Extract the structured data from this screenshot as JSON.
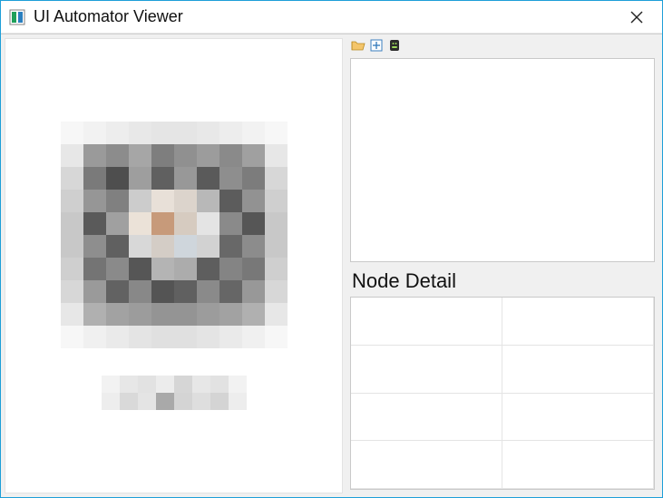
{
  "window": {
    "title": "UI Automator Viewer"
  },
  "rightPanel": {
    "nodeDetailLabel": "Node Detail"
  },
  "icons": {
    "open": "open-folder-icon",
    "screenshot": "screenshot-icon",
    "device": "device-icon",
    "close": "close-icon",
    "app": "app-icon"
  },
  "pixelArt": {
    "rows": [
      [
        "#f7f7f7",
        "#f2f2f2",
        "#ededed",
        "#e8e8e8",
        "#e5e5e5",
        "#e5e5e5",
        "#e8e8e8",
        "#ededed",
        "#f2f2f2",
        "#f7f7f7"
      ],
      [
        "#e7e7e7",
        "#9a9a9a",
        "#8c8c8c",
        "#a6a6a6",
        "#7e7e7e",
        "#909090",
        "#9c9c9c",
        "#8a8a8a",
        "#a0a0a0",
        "#e7e7e7"
      ],
      [
        "#d7d7d7",
        "#7a7a7a",
        "#4e4e4e",
        "#9e9e9e",
        "#606060",
        "#989898",
        "#5a5a5a",
        "#8e8e8e",
        "#7c7c7c",
        "#d7d7d7"
      ],
      [
        "#cfcfcf",
        "#969696",
        "#808080",
        "#cccccc",
        "#e8e0d8",
        "#dcd4cc",
        "#b8b8b8",
        "#5c5c5c",
        "#929292",
        "#cfcfcf"
      ],
      [
        "#c8c8c8",
        "#5a5a5a",
        "#a0a0a0",
        "#ebe2d8",
        "#c79a7a",
        "#d6cbc0",
        "#e4e4e4",
        "#8a8a8a",
        "#565656",
        "#c8c8c8"
      ],
      [
        "#c8c8c8",
        "#8e8e8e",
        "#606060",
        "#d8d8d8",
        "#d4cdc6",
        "#cfd6dc",
        "#d2d2d2",
        "#686868",
        "#8c8c8c",
        "#c8c8c8"
      ],
      [
        "#cfcfcf",
        "#747474",
        "#8a8a8a",
        "#565656",
        "#b4b4b4",
        "#acacac",
        "#5e5e5e",
        "#848484",
        "#787878",
        "#cfcfcf"
      ],
      [
        "#d7d7d7",
        "#9a9a9a",
        "#626262",
        "#888888",
        "#545454",
        "#606060",
        "#8a8a8a",
        "#666666",
        "#989898",
        "#d7d7d7"
      ],
      [
        "#e7e7e7",
        "#b0b0b0",
        "#a2a2a2",
        "#9c9c9c",
        "#949494",
        "#949494",
        "#9c9c9c",
        "#a2a2a2",
        "#b0b0b0",
        "#e7e7e7"
      ],
      [
        "#f7f7f7",
        "#f0f0f0",
        "#eaeaea",
        "#e4e4e4",
        "#e0e0e0",
        "#e0e0e0",
        "#e4e4e4",
        "#eaeaea",
        "#f0f0f0",
        "#f7f7f7"
      ]
    ]
  },
  "captionArt": {
    "rows": [
      [
        "#f2f2f2",
        "#e7e7e7",
        "#e2e2e2",
        "#ececec",
        "#d6d6d6",
        "#e7e7e7",
        "#e2e2e2",
        "#f2f2f2"
      ],
      [
        "#ededed",
        "#d9d9d9",
        "#e4e4e4",
        "#a9a9a9",
        "#d4d4d4",
        "#dedede",
        "#d4d4d4",
        "#ededed"
      ]
    ]
  }
}
